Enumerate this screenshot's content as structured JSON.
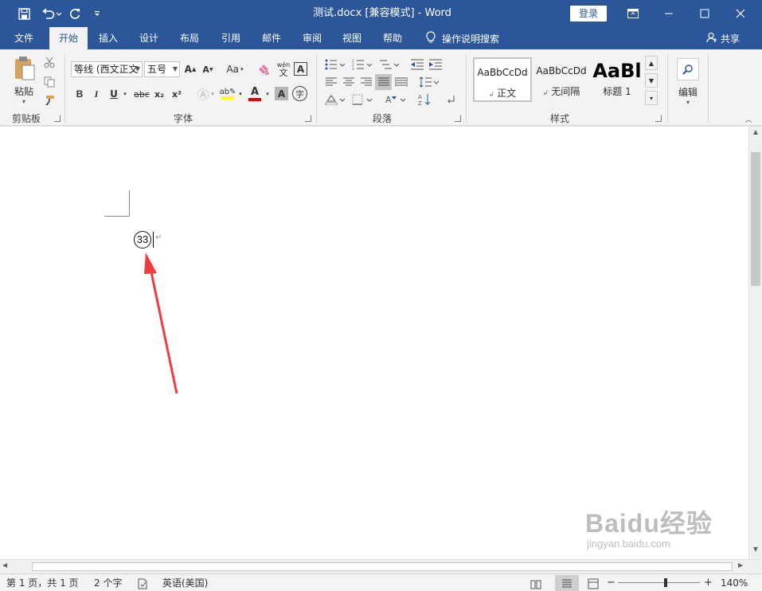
{
  "window": {
    "title": "测试.docx [兼容模式] - Word",
    "login_label": "登录"
  },
  "tabs": [
    {
      "label": "文件"
    },
    {
      "label": "开始",
      "active": true
    },
    {
      "label": "插入"
    },
    {
      "label": "设计"
    },
    {
      "label": "布局"
    },
    {
      "label": "引用"
    },
    {
      "label": "邮件"
    },
    {
      "label": "审阅"
    },
    {
      "label": "视图"
    },
    {
      "label": "帮助"
    }
  ],
  "tell_me": "操作说明搜索",
  "share": "共享",
  "ribbon": {
    "clipboard": {
      "label": "剪贴板",
      "paste_label": "粘贴"
    },
    "font": {
      "label": "字体",
      "font_name": "等线 (西文正文",
      "font_size": "五号",
      "case_label": "Aa",
      "phonetic_top": "wén",
      "phonetic_bottom": "文",
      "bold": "B",
      "italic": "I",
      "underline": "U",
      "strike": "abc",
      "subscript": "x₂",
      "superscript": "x²",
      "font_color_letter": "A",
      "char_shading": "A",
      "enclose_char": "字",
      "border_char": "A"
    },
    "paragraph": {
      "label": "段落"
    },
    "styles": {
      "label": "样式",
      "items": [
        {
          "sample": "AaBbCcDd",
          "name": "正文",
          "mark": "↲"
        },
        {
          "sample": "AaBbCcDd",
          "name": "无间隔",
          "mark": "↲"
        },
        {
          "sample": "AaBl",
          "name": "标题 1"
        }
      ]
    },
    "editing": {
      "label": "编辑"
    }
  },
  "document": {
    "enclosed_text": "33",
    "paragraph_mark": "↵"
  },
  "statusbar": {
    "page": "第 1 页，共 1 页",
    "words": "2 个字",
    "language": "英语(美国)",
    "zoom": "140%"
  },
  "watermark": {
    "brand": "Baidu经验",
    "url": "jingyan.baidu.com"
  },
  "colors": {
    "accent": "#2b579a",
    "highlight": "#ffff00",
    "font_color": "#e00000",
    "arrow": "#f03c3c"
  }
}
